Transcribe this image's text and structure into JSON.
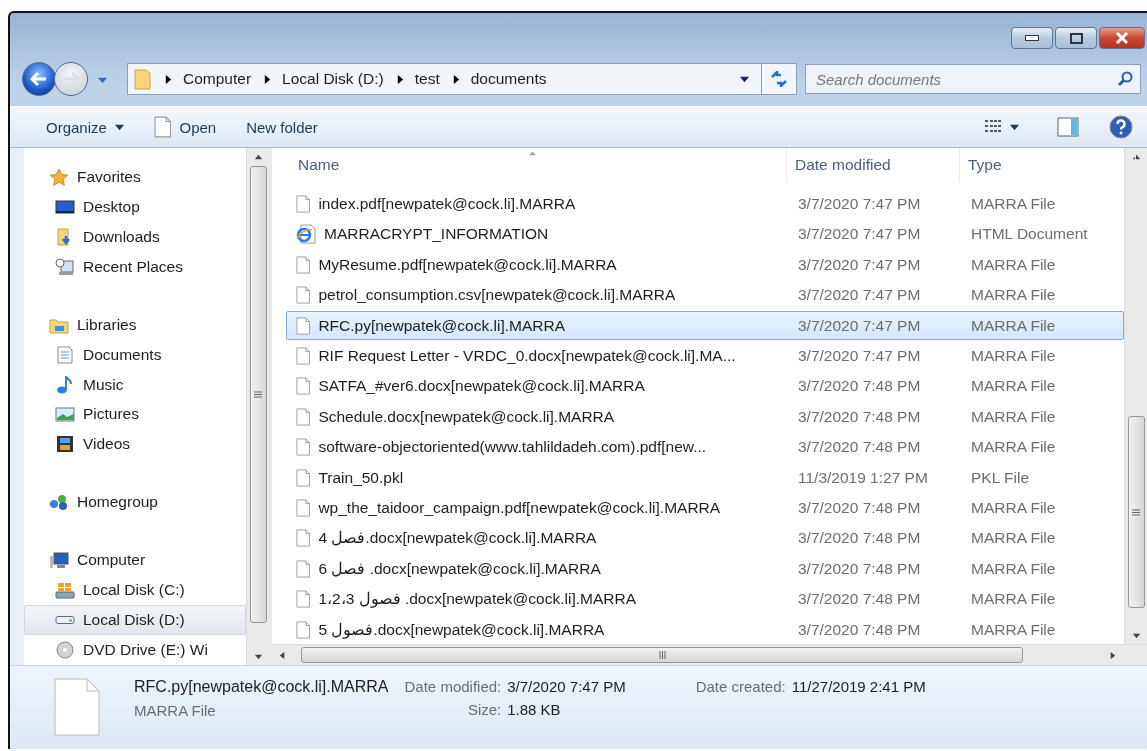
{
  "address": {
    "breadcrumb": [
      "Computer",
      "Local Disk (D:)",
      "test",
      "documents"
    ]
  },
  "search": {
    "placeholder": "Search documents"
  },
  "toolbar": {
    "buttons": [
      {
        "label": "Organize",
        "kind": "menu"
      },
      {
        "label": "Open",
        "kind": "file"
      },
      {
        "label": "New folder",
        "kind": "plain"
      }
    ]
  },
  "sidebar": {
    "groups": [
      {
        "label": "Favorites",
        "selected": false,
        "children": [
          {
            "label": "Desktop",
            "selected": false
          },
          {
            "label": "Downloads",
            "selected": false
          },
          {
            "label": "Recent Places",
            "selected": false
          }
        ]
      },
      {
        "label": "Libraries",
        "selected": false,
        "children": [
          {
            "label": "Documents",
            "selected": false
          },
          {
            "label": "Music",
            "selected": false
          },
          {
            "label": "Pictures",
            "selected": false
          },
          {
            "label": "Videos",
            "selected": false
          }
        ]
      },
      {
        "label": "Homegroup",
        "selected": false
      },
      {
        "label": "Computer",
        "selected": false,
        "children": [
          {
            "label": "Local Disk (C:)",
            "selected": false
          },
          {
            "label": "Local Disk (D:)",
            "selected": true
          },
          {
            "label": "DVD Drive (E:) Wi",
            "selected": false
          }
        ]
      }
    ]
  },
  "table": {
    "columns": [
      {
        "label": "Name",
        "sorted": true
      },
      {
        "label": "Date modified",
        "sorted": false
      },
      {
        "label": "Type",
        "sorted": false
      }
    ],
    "rows": [
      {
        "name": "index.pdf[newpatek@cock.li].MARRA",
        "date": "3/7/2020 7:47 PM",
        "type": "MARRA File",
        "kind": "file",
        "selected": false
      },
      {
        "name": "MARRACRYPT_INFORMATION",
        "date": "3/7/2020 7:47 PM",
        "type": "HTML Document",
        "kind": "web",
        "selected": false
      },
      {
        "name": "MyResume.pdf[newpatek@cock.li].MARRA",
        "date": "3/7/2020 7:47 PM",
        "type": "MARRA File",
        "kind": "file",
        "selected": false
      },
      {
        "name": "petrol_consumption.csv[newpatek@cock.li].MARRA",
        "date": "3/7/2020 7:47 PM",
        "type": "MARRA File",
        "kind": "file",
        "selected": false
      },
      {
        "name": "RFC.py[newpatek@cock.li].MARRA",
        "date": "3/7/2020 7:47 PM",
        "type": "MARRA File",
        "kind": "file",
        "selected": true
      },
      {
        "name": "RIF Request Letter - VRDC_0.docx[newpatek@cock.li].MA...",
        "date": "3/7/2020 7:47 PM",
        "type": "MARRA File",
        "kind": "file",
        "selected": false
      },
      {
        "name": "SATFA_#ver6.docx[newpatek@cock.li].MARRA",
        "date": "3/7/2020 7:48 PM",
        "type": "MARRA File",
        "kind": "file",
        "selected": false
      },
      {
        "name": "Schedule.docx[newpatek@cock.li].MARRA",
        "date": "3/7/2020 7:48 PM",
        "type": "MARRA File",
        "kind": "file",
        "selected": false
      },
      {
        "name": "software-objectoriented(www.tahlildadeh.com).pdf[new...",
        "date": "3/7/2020 7:48 PM",
        "type": "MARRA File",
        "kind": "file",
        "selected": false
      },
      {
        "name": "Train_50.pkl",
        "date": "11/3/2019 1:27 PM",
        "type": "PKL File",
        "kind": "file",
        "selected": false
      },
      {
        "name": "wp_the_taidoor_campaign.pdf[newpatek@cock.li].MARRA",
        "date": "3/7/2020 7:48 PM",
        "type": "MARRA File",
        "kind": "file",
        "selected": false
      },
      {
        "name": "فصل 4.docx[newpatek@cock.li].MARRA",
        "date": "3/7/2020 7:48 PM",
        "type": "MARRA File",
        "kind": "file",
        "selected": false
      },
      {
        "name": "فصل 6 .docx[newpatek@cock.li].MARRA",
        "date": "3/7/2020 7:48 PM",
        "type": "MARRA File",
        "kind": "file",
        "selected": false
      },
      {
        "name": "فصول 1،2،3 .docx[newpatek@cock.li].MARRA",
        "date": "3/7/2020 7:48 PM",
        "type": "MARRA File",
        "kind": "file",
        "selected": false
      },
      {
        "name": "فصول 5.docx[newpatek@cock.li].MARRA",
        "date": "3/7/2020 7:48 PM",
        "type": "MARRA File",
        "kind": "file",
        "selected": false
      }
    ]
  },
  "details": {
    "name": "RFC.py[newpatek@cock.li].MARRA",
    "type": "MARRA File",
    "groups": [
      [
        {
          "label": "Date modified:",
          "value": "3/7/2020 7:47 PM"
        },
        {
          "label": "Size:",
          "value": "1.88 KB"
        }
      ],
      [
        {
          "label": "Date created:",
          "value": "11/27/2019 2:41 PM"
        }
      ]
    ]
  }
}
